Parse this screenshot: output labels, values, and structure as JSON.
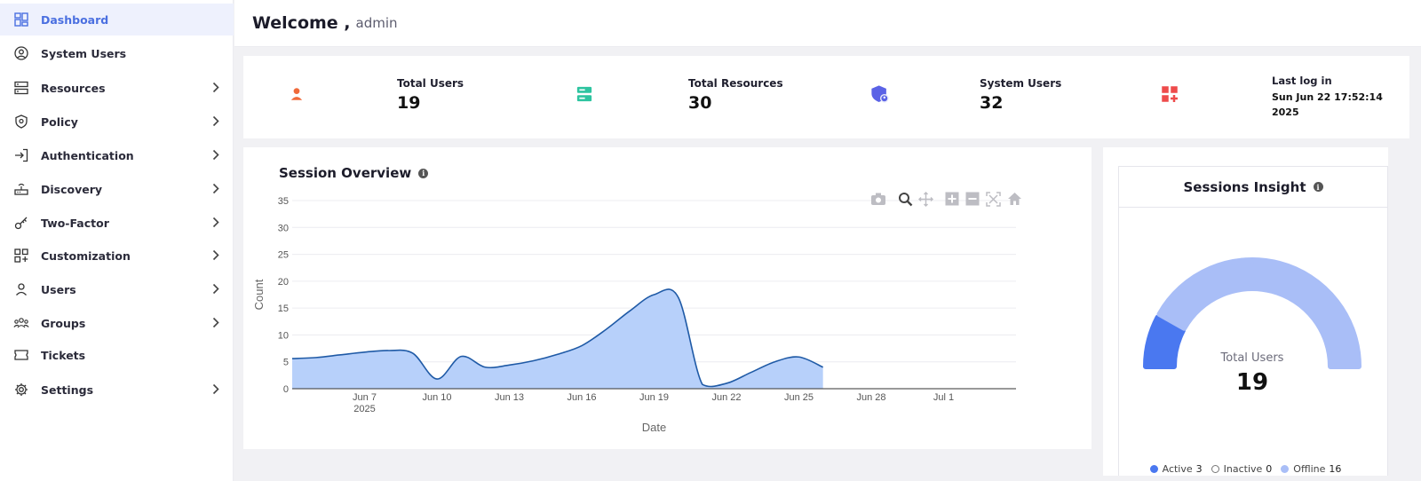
{
  "sidebar": {
    "items": [
      {
        "label": "Dashboard",
        "icon": "dashboard-icon",
        "active": true,
        "chevron": false
      },
      {
        "label": "System Users",
        "icon": "user-circle-icon",
        "active": false,
        "chevron": false
      },
      {
        "label": "Resources",
        "icon": "server-icon",
        "active": false,
        "chevron": true
      },
      {
        "label": "Policy",
        "icon": "shield-icon",
        "active": false,
        "chevron": true
      },
      {
        "label": "Authentication",
        "icon": "login-icon",
        "active": false,
        "chevron": true
      },
      {
        "label": "Discovery",
        "icon": "router-icon",
        "active": false,
        "chevron": true
      },
      {
        "label": "Two-Factor",
        "icon": "key-icon",
        "active": false,
        "chevron": true
      },
      {
        "label": "Customization",
        "icon": "widgets-add-icon",
        "active": false,
        "chevron": true
      },
      {
        "label": "Users",
        "icon": "user-icon",
        "active": false,
        "chevron": true
      },
      {
        "label": "Groups",
        "icon": "groups-icon",
        "active": false,
        "chevron": true
      },
      {
        "label": "Tickets",
        "icon": "ticket-icon",
        "active": false,
        "chevron": false
      },
      {
        "label": "Settings",
        "icon": "gear-icon",
        "active": false,
        "chevron": true
      }
    ]
  },
  "header": {
    "welcome": "Welcome ,",
    "username": "admin"
  },
  "stats": [
    {
      "label": "Total Users",
      "value": "19",
      "icon": "user-icon",
      "bg": "#fdeee6",
      "color": "#f06a3a"
    },
    {
      "label": "Total Resources",
      "value": "30",
      "icon": "server-icon",
      "bg": "#e6f8f3",
      "color": "#2ec4a0"
    },
    {
      "label": "System Users",
      "value": "32",
      "icon": "shield-user-icon",
      "bg": "#e9ebfb",
      "color": "#5b63e6"
    },
    {
      "label": "Last log in",
      "value": "Sun Jun 22 17:52:14",
      "value2": "2025",
      "icon": "widgets-add-icon",
      "bg": "#fdf2e3",
      "color": "#ee4b4b"
    }
  ],
  "session_overview": {
    "title": "Session Overview",
    "info": "i"
  },
  "chart_data": {
    "type": "area",
    "x_dates": [
      "2025-06-04",
      "2025-06-05",
      "2025-06-06",
      "2025-06-07",
      "2025-06-08",
      "2025-06-09",
      "2025-06-10",
      "2025-06-11",
      "2025-06-12",
      "2025-06-13",
      "2025-06-14",
      "2025-06-15",
      "2025-06-16",
      "2025-06-17",
      "2025-06-18",
      "2025-06-19",
      "2025-06-20",
      "2025-06-21",
      "2025-06-22",
      "2025-06-23",
      "2025-06-24",
      "2025-06-25",
      "2025-06-26"
    ],
    "values": [
      5.6,
      5.8,
      6.3,
      6.8,
      7.1,
      6.6,
      1.8,
      6.0,
      4.0,
      4.4,
      5.2,
      6.4,
      8.0,
      11.0,
      14.5,
      17.5,
      17.0,
      0.8,
      1.0,
      3.0,
      5.0,
      5.9,
      4.0
    ],
    "xlabel": "Date",
    "ylabel": "Count",
    "ylim": [
      0,
      35
    ],
    "y_ticks": [
      "0",
      "5",
      "10",
      "15",
      "20",
      "25",
      "30",
      "35"
    ],
    "x_ticks": [
      {
        "date": "2025-06-07",
        "label": "Jun 7",
        "sub": "2025"
      },
      {
        "date": "2025-06-10",
        "label": "Jun 10",
        "sub": ""
      },
      {
        "date": "2025-06-13",
        "label": "Jun 13",
        "sub": ""
      },
      {
        "date": "2025-06-16",
        "label": "Jun 16",
        "sub": ""
      },
      {
        "date": "2025-06-19",
        "label": "Jun 19",
        "sub": ""
      },
      {
        "date": "2025-06-22",
        "label": "Jun 22",
        "sub": ""
      },
      {
        "date": "2025-06-25",
        "label": "Jun 25",
        "sub": ""
      },
      {
        "date": "2025-06-28",
        "label": "Jun 28",
        "sub": ""
      },
      {
        "date": "2025-07-01",
        "label": "Jul 1",
        "sub": ""
      }
    ],
    "xlim": [
      "2025-06-04",
      "2025-07-04"
    ],
    "grid": true,
    "line_color": "#1f5aa6",
    "fill_color": "#b7d0fa"
  },
  "insight": {
    "title": "Sessions Insight",
    "info": "i",
    "center_label": "Total Users",
    "center_value": "19",
    "segments": [
      {
        "name": "Active",
        "value": 3,
        "color": "#4a78f0"
      },
      {
        "name": "Inactive",
        "value": 0,
        "color": "#ffffff"
      },
      {
        "name": "Offline",
        "value": 16,
        "color": "#a9bef7"
      }
    ],
    "legend": [
      {
        "name": "Active",
        "count": "3",
        "color": "#4a78f0"
      },
      {
        "name": "Inactive",
        "count": "0",
        "color": "#ffffff"
      },
      {
        "name": "Offline",
        "count": "16",
        "color": "#a9bef7"
      }
    ]
  },
  "toolbar": [
    "camera-icon",
    "zoom-icon",
    "pan-icon",
    "zoom-in-icon",
    "zoom-out-icon",
    "autoscale-icon",
    "home-icon"
  ]
}
